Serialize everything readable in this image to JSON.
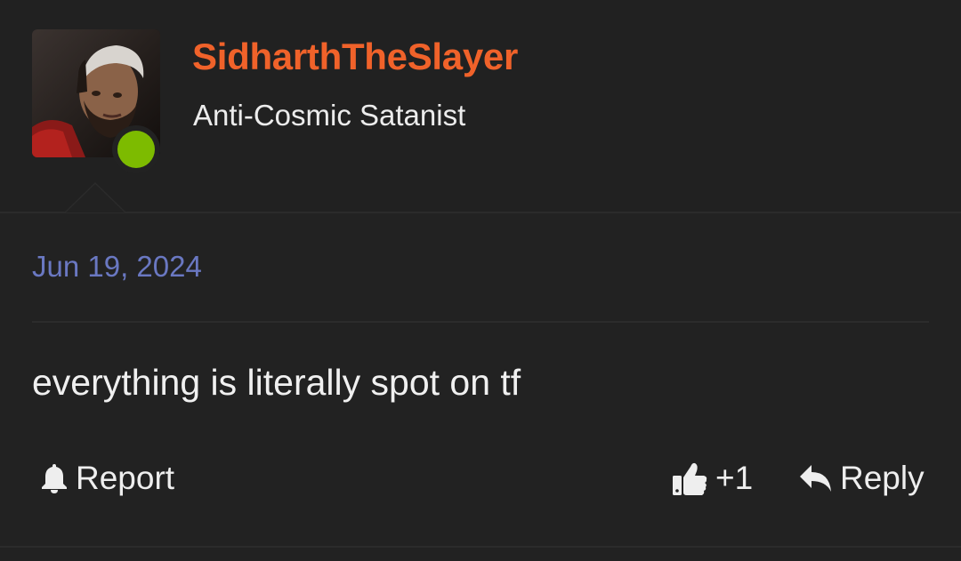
{
  "user": {
    "username": "SidharthTheSlayer",
    "title": "Anti-Cosmic Satanist",
    "online": true
  },
  "post": {
    "date": "Jun 19, 2024",
    "body": "everything is literally spot on tf"
  },
  "actions": {
    "report_label": "Report",
    "like_count": "+1",
    "reply_label": "Reply"
  },
  "icons": {
    "report": "bell-icon",
    "like": "thumbs-up-icon",
    "reply": "reply-arrow-icon"
  },
  "colors": {
    "username": "#f0622a",
    "date": "#6a78c2",
    "online": "#7dbb00",
    "background": "#222222"
  }
}
